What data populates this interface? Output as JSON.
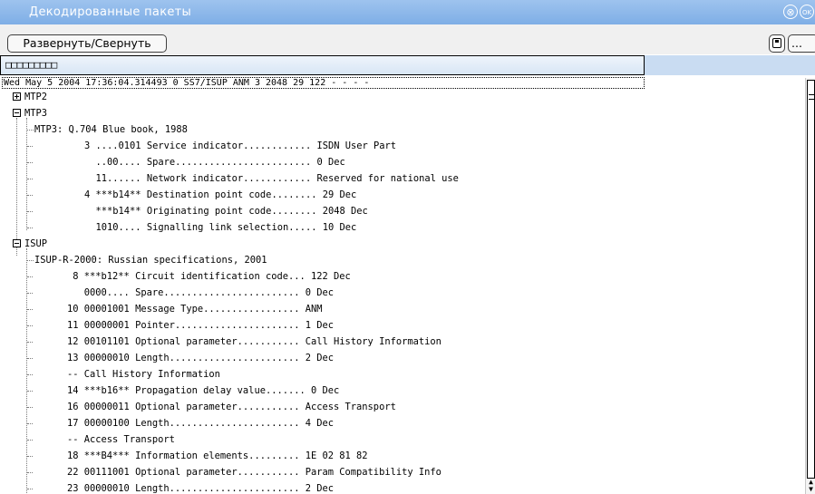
{
  "window": {
    "title": "Декодированные пакеты",
    "close_glyph": "⊗",
    "second_glyph": "OK"
  },
  "toolbar": {
    "expand_label": "Развернуть/Свернуть",
    "more_label": "..."
  },
  "header": {
    "placeholder": "□□□□□□□□□"
  },
  "packet_header": "Wed May 5 2004 17:36:04.314493 0 SS7/ISUP ANM 3 2048 29 122 - - - -",
  "tree": {
    "mtp2": {
      "label": "MTP2",
      "expanded": false
    },
    "mtp3": {
      "label": "MTP3",
      "expanded": true,
      "rows": [
        "MTP3: Q.704 Blue book, 1988",
        "3 ....0101 Service indicator............ ISDN User Part",
        "  ..00.... Spare........................ 0 Dec",
        "  11...... Network indicator............ Reserved for national use",
        "4 ***b14** Destination point code........ 29 Dec",
        "  ***b14** Originating point code........ 2048 Dec",
        "  1010.... Signalling link selection..... 10 Dec"
      ]
    },
    "isup": {
      "label": "ISUP",
      "expanded": true,
      "rows": [
        "ISUP-R-2000: Russian specifications, 2001",
        " 8 ***b12** Circuit identification code... 122 Dec",
        "   0000.... Spare........................ 0 Dec",
        "10 00001001 Message Type................. ANM",
        "11 00000001 Pointer...................... 1 Dec",
        "12 00101101 Optional parameter........... Call History Information",
        "13 00000010 Length....................... 2 Dec",
        "-- Call History Information",
        "14 ***b16** Propagation delay value....... 0 Dec",
        "16 00000011 Optional parameter........... Access Transport",
        "17 00000100 Length....................... 4 Dec",
        "-- Access Transport",
        "18 ***B4*** Information elements......... 1E 02 81 82",
        "22 00111001 Optional parameter........... Param Compatibility Info",
        "23 00000010 Length....................... 2 Dec"
      ]
    }
  }
}
